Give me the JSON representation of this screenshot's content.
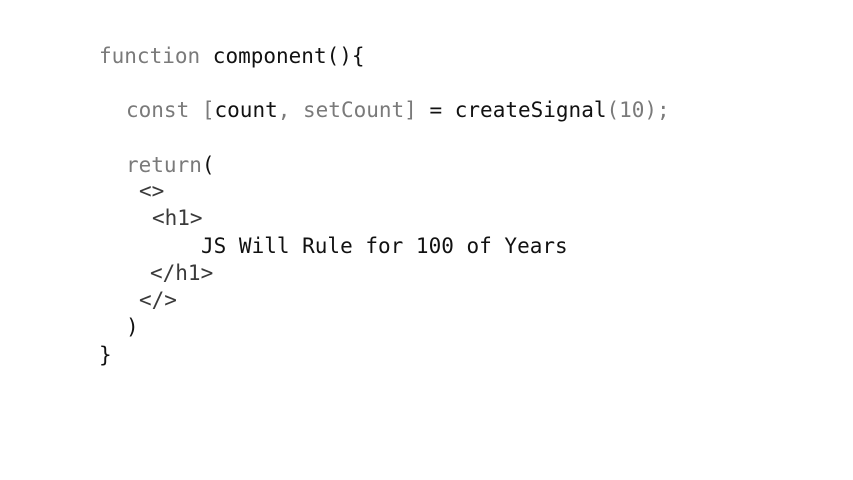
{
  "code": {
    "line1": {
      "keyword": "function",
      "name": " component(){"
    },
    "line2": {
      "keyword": "const ",
      "open_bracket": "[",
      "count": "count",
      "sep": ", setCount",
      "close_bracket": "]",
      "assign": " = ",
      "call": "createSignal",
      "args": "(10);"
    },
    "line3": {
      "keyword": "return",
      "paren": "("
    },
    "line4": "<>",
    "line5": "<h1>",
    "line6": "JS Will Rule for 100 of Years",
    "line7": "</h1>",
    "line8": "</>",
    "line9": ")",
    "line10": "}"
  }
}
